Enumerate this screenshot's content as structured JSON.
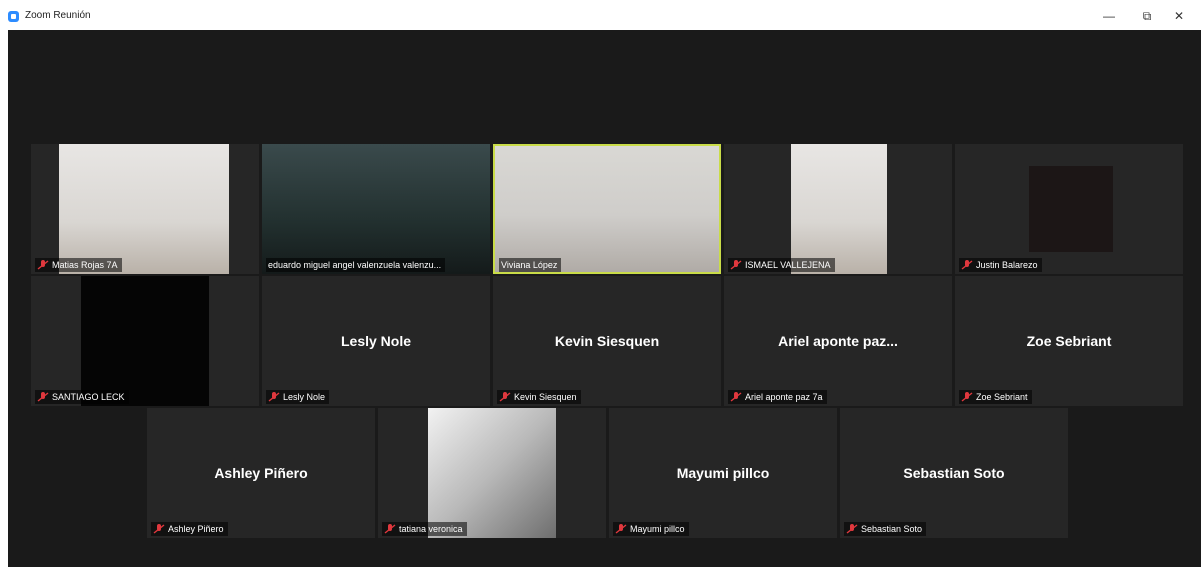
{
  "window": {
    "title": "Zoom Reunión",
    "minimize": "—",
    "restore": "⧉",
    "close": "✕"
  },
  "colors": {
    "background": "#1a1a1a",
    "tile": "#262626",
    "active_speaker_border": "#c9dc48",
    "muted_icon": "#e0383e"
  },
  "participants": [
    {
      "display": "Matias Rojas 7A",
      "centered_name": "",
      "video": "photo",
      "muted": true,
      "active": false
    },
    {
      "display": "eduardo miguel angel valenzuela valenzu...",
      "centered_name": "",
      "video": "photo",
      "muted": false,
      "active": false
    },
    {
      "display": "Viviana López",
      "centered_name": "",
      "video": "photo",
      "muted": false,
      "active": true
    },
    {
      "display": "ISMAEL VALLEJENA",
      "centered_name": "",
      "video": "photo",
      "muted": true,
      "active": false
    },
    {
      "display": "Justin Balarezo",
      "centered_name": "",
      "video": "avatar",
      "muted": true,
      "active": false
    },
    {
      "display": "SANTIAGO LECK",
      "centered_name": "",
      "video": "black",
      "muted": true,
      "active": false
    },
    {
      "display": "Lesly Nole",
      "centered_name": "Lesly Nole",
      "video": "none",
      "muted": true,
      "active": false
    },
    {
      "display": "Kevin Siesquen",
      "centered_name": "Kevin Siesquen",
      "video": "none",
      "muted": true,
      "active": false
    },
    {
      "display": "Ariel aponte paz 7a",
      "centered_name": "Ariel aponte paz...",
      "video": "none",
      "muted": true,
      "active": false
    },
    {
      "display": "Zoe Sebriant",
      "centered_name": "Zoe Sebriant",
      "video": "none",
      "muted": true,
      "active": false
    },
    {
      "display": "Ashley Piñero",
      "centered_name": "Ashley Piñero",
      "video": "none",
      "muted": true,
      "active": false
    },
    {
      "display": "tatiana veronica",
      "centered_name": "",
      "video": "avatar-bw",
      "muted": true,
      "active": false
    },
    {
      "display": "Mayumi pillco",
      "centered_name": "Mayumi pillco",
      "video": "none",
      "muted": true,
      "active": false
    },
    {
      "display": "Sebastian Soto",
      "centered_name": "Sebastian Soto",
      "video": "none",
      "muted": true,
      "active": false
    }
  ]
}
